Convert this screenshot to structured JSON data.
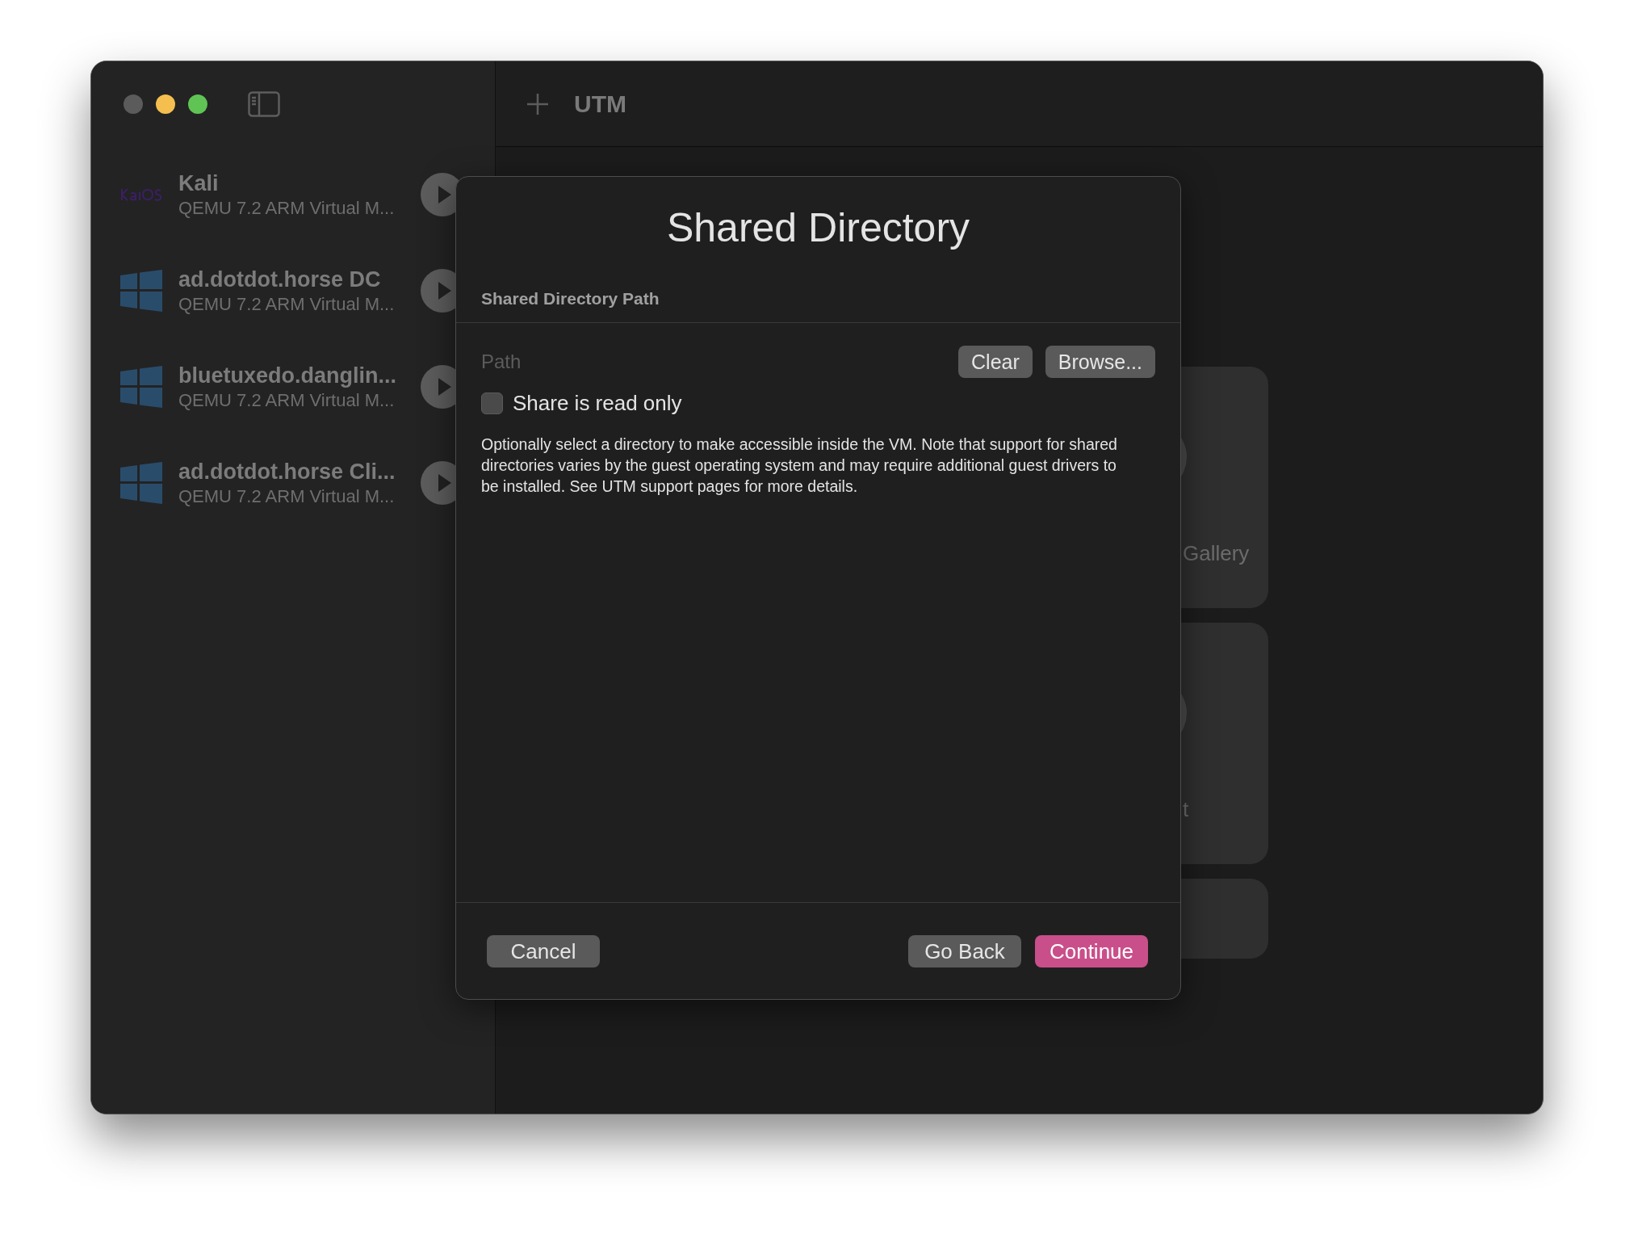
{
  "toolbar": {
    "title": "UTM"
  },
  "sidebar": {
    "items": [
      {
        "kind": "kali",
        "name": "Kali",
        "subtitle": "QEMU 7.2 ARM Virtual M..."
      },
      {
        "kind": "windows",
        "name": "ad.dotdot.horse DC",
        "subtitle": "QEMU 7.2 ARM Virtual M..."
      },
      {
        "kind": "windows",
        "name": "bluetuxedo.danglin...",
        "subtitle": "QEMU 7.2 ARM Virtual M..."
      },
      {
        "kind": "windows",
        "name": "ad.dotdot.horse Cli...",
        "subtitle": "QEMU 7.2 ARM Virtual M..."
      }
    ]
  },
  "cards": [
    {
      "kind": "tile",
      "label": "Gallery"
    },
    {
      "kind": "tile",
      "label": "t"
    },
    {
      "kind": "strip"
    }
  ],
  "dialog": {
    "title": "Shared Directory",
    "section_label": "Shared Directory Path",
    "path_field": {
      "placeholder": "Path"
    },
    "field_buttons": [
      {
        "label": "Clear"
      },
      {
        "label": "Browse..."
      }
    ],
    "checkbox": {
      "label": "Share is read only",
      "checked": false
    },
    "description": "Optionally select a directory to make accessible inside the VM. Note that support for shared directories varies by the guest operating system and may require additional guest drivers to be installed. See UTM support pages for more details.",
    "footer_left": [
      {
        "label": "Cancel",
        "kind": "secondary"
      }
    ],
    "footer_right": [
      {
        "label": "Go Back",
        "kind": "secondary"
      },
      {
        "label": "Continue",
        "kind": "primary"
      }
    ]
  }
}
